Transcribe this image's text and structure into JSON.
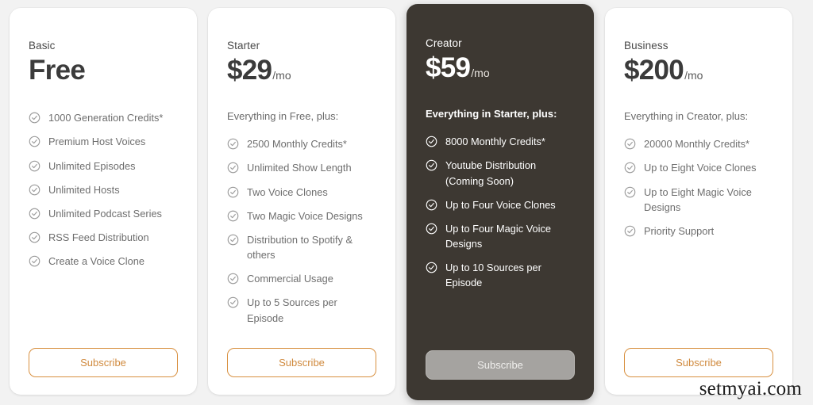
{
  "watermark": "setmyai.com",
  "icons": {
    "feature_check": "check-circle-icon"
  },
  "colors": {
    "accent_orange": "#d89040",
    "featured_card_bg": "#3d3832",
    "featured_button_bg": "#a5a3a0",
    "page_bg": "#f2f2f2",
    "card_bg": "#ffffff"
  },
  "plans": [
    {
      "name": "Basic",
      "price": "Free",
      "period": "",
      "intro": "",
      "featured": false,
      "cta": "Subscribe",
      "features": [
        "1000 Generation Credits*",
        "Premium Host Voices",
        "Unlimited Episodes",
        "Unlimited Hosts",
        "Unlimited Podcast Series",
        "RSS Feed Distribution",
        "Create a Voice Clone"
      ]
    },
    {
      "name": "Starter",
      "price": "$29",
      "period": "/mo",
      "intro": "Everything in Free, plus:",
      "featured": false,
      "cta": "Subscribe",
      "features": [
        "2500 Monthly Credits*",
        "Unlimited Show Length",
        "Two Voice Clones",
        "Two Magic Voice Designs",
        "Distribution to Spotify & others",
        "Commercial Usage",
        "Up to 5 Sources per Episode"
      ]
    },
    {
      "name": "Creator",
      "price": "$59",
      "period": "/mo",
      "intro": "Everything in Starter, plus:",
      "featured": true,
      "cta": "Subscribe",
      "features": [
        "8000 Monthly Credits*",
        "Youtube Distribution (Coming Soon)",
        "Up to Four Voice Clones",
        "Up to Four Magic Voice Designs",
        "Up to 10 Sources per Episode"
      ]
    },
    {
      "name": "Business",
      "price": "$200",
      "period": "/mo",
      "intro": "Everything in Creator, plus:",
      "featured": false,
      "cta": "Subscribe",
      "features": [
        "20000 Monthly Credits*",
        "Up to Eight Voice Clones",
        "Up to Eight Magic Voice Designs",
        "Priority Support"
      ]
    }
  ]
}
